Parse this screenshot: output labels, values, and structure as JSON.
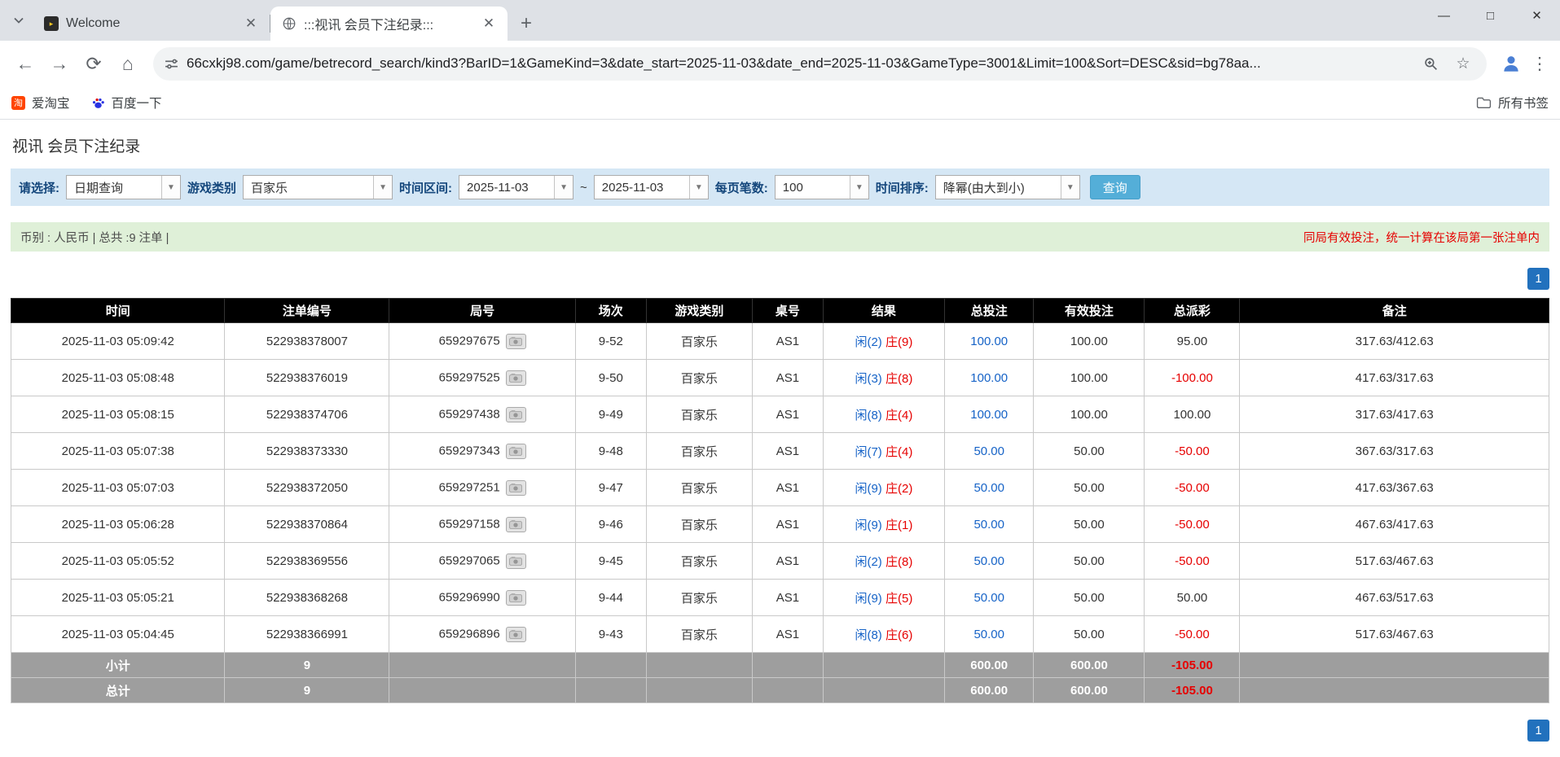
{
  "browser": {
    "tabs": [
      {
        "title": "Welcome"
      },
      {
        "title": ":::视讯 会员下注纪录:::"
      }
    ],
    "url": "66cxkj98.com/game/betrecord_search/kind3?BarID=1&GameKind=3&date_start=2025-11-03&date_end=2025-11-03&GameType=3001&Limit=100&Sort=DESC&sid=bg78aa...",
    "bookmarks": {
      "item1": "爱淘宝",
      "item2": "百度一下",
      "all_bookmarks": "所有书签"
    }
  },
  "page": {
    "title": "视讯 会员下注纪录",
    "filters": {
      "select_label": "请选择:",
      "select_value": "日期查询",
      "game_type_label": "游戏类别",
      "game_type_value": "百家乐",
      "date_range_label": "时间区间:",
      "date_start": "2025-11-03",
      "tilde": "~",
      "date_end": "2025-11-03",
      "per_page_label": "每页笔数:",
      "per_page_value": "100",
      "sort_label": "时间排序:",
      "sort_value": "降幂(由大到小)",
      "search_button": "查询"
    },
    "summary": {
      "left": "币别 : 人民币 | 总共 :9 注单 |",
      "right": "同局有效投注，统一计算在该局第一张注单内"
    },
    "pagination": {
      "page": "1"
    },
    "table": {
      "headers": [
        "时间",
        "注单编号",
        "局号",
        "场次",
        "游戏类别",
        "桌号",
        "结果",
        "总投注",
        "有效投注",
        "总派彩",
        "备注"
      ],
      "rows": [
        {
          "time": "2025-11-03 05:09:42",
          "bet_id": "522938378007",
          "round_id": "659297675",
          "session": "9-52",
          "game": "百家乐",
          "table": "AS1",
          "result_player": "闲(2)",
          "result_banker": "庄(9)",
          "total_bet": "100.00",
          "valid_bet": "100.00",
          "payout": "95.00",
          "note": "317.63/412.63"
        },
        {
          "time": "2025-11-03 05:08:48",
          "bet_id": "522938376019",
          "round_id": "659297525",
          "session": "9-50",
          "game": "百家乐",
          "table": "AS1",
          "result_player": "闲(3)",
          "result_banker": "庄(8)",
          "total_bet": "100.00",
          "valid_bet": "100.00",
          "payout": "-100.00",
          "note": "417.63/317.63"
        },
        {
          "time": "2025-11-03 05:08:15",
          "bet_id": "522938374706",
          "round_id": "659297438",
          "session": "9-49",
          "game": "百家乐",
          "table": "AS1",
          "result_player": "闲(8)",
          "result_banker": "庄(4)",
          "total_bet": "100.00",
          "valid_bet": "100.00",
          "payout": "100.00",
          "note": "317.63/417.63"
        },
        {
          "time": "2025-11-03 05:07:38",
          "bet_id": "522938373330",
          "round_id": "659297343",
          "session": "9-48",
          "game": "百家乐",
          "table": "AS1",
          "result_player": "闲(7)",
          "result_banker": "庄(4)",
          "total_bet": "50.00",
          "valid_bet": "50.00",
          "payout": "-50.00",
          "note": "367.63/317.63"
        },
        {
          "time": "2025-11-03 05:07:03",
          "bet_id": "522938372050",
          "round_id": "659297251",
          "session": "9-47",
          "game": "百家乐",
          "table": "AS1",
          "result_player": "闲(9)",
          "result_banker": "庄(2)",
          "total_bet": "50.00",
          "valid_bet": "50.00",
          "payout": "-50.00",
          "note": "417.63/367.63"
        },
        {
          "time": "2025-11-03 05:06:28",
          "bet_id": "522938370864",
          "round_id": "659297158",
          "session": "9-46",
          "game": "百家乐",
          "table": "AS1",
          "result_player": "闲(9)",
          "result_banker": "庄(1)",
          "total_bet": "50.00",
          "valid_bet": "50.00",
          "payout": "-50.00",
          "note": "467.63/417.63"
        },
        {
          "time": "2025-11-03 05:05:52",
          "bet_id": "522938369556",
          "round_id": "659297065",
          "session": "9-45",
          "game": "百家乐",
          "table": "AS1",
          "result_player": "闲(2)",
          "result_banker": "庄(8)",
          "total_bet": "50.00",
          "valid_bet": "50.00",
          "payout": "-50.00",
          "note": "517.63/467.63"
        },
        {
          "time": "2025-11-03 05:05:21",
          "bet_id": "522938368268",
          "round_id": "659296990",
          "session": "9-44",
          "game": "百家乐",
          "table": "AS1",
          "result_player": "闲(9)",
          "result_banker": "庄(5)",
          "total_bet": "50.00",
          "valid_bet": "50.00",
          "payout": "50.00",
          "note": "467.63/517.63"
        },
        {
          "time": "2025-11-03 05:04:45",
          "bet_id": "522938366991",
          "round_id": "659296896",
          "session": "9-43",
          "game": "百家乐",
          "table": "AS1",
          "result_player": "闲(8)",
          "result_banker": "庄(6)",
          "total_bet": "50.00",
          "valid_bet": "50.00",
          "payout": "-50.00",
          "note": "517.63/467.63"
        }
      ],
      "subtotal": {
        "label": "小计",
        "count": "9",
        "total_bet": "600.00",
        "valid_bet": "600.00",
        "payout": "-105.00"
      },
      "total": {
        "label": "总计",
        "count": "9",
        "total_bet": "600.00",
        "valid_bet": "600.00",
        "payout": "-105.00"
      }
    }
  }
}
